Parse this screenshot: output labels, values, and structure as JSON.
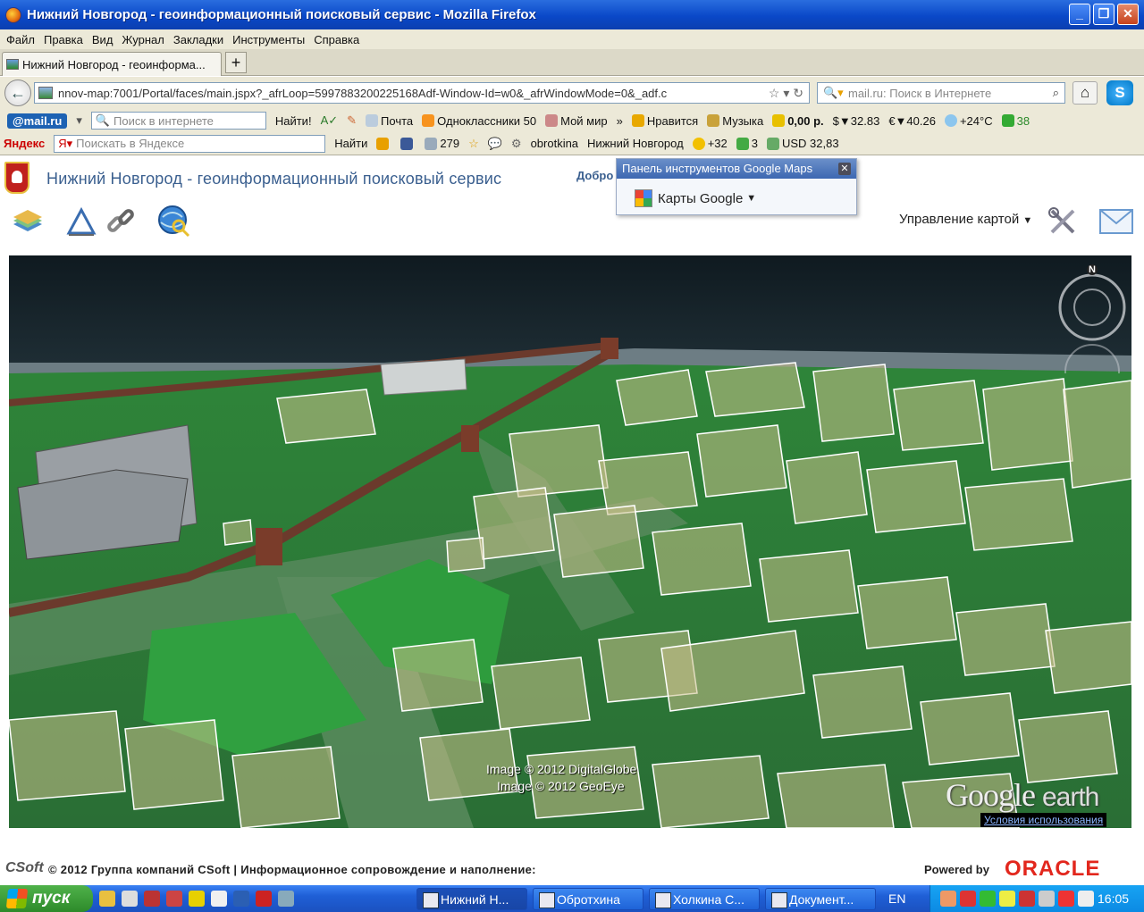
{
  "window": {
    "title": "Нижний Новгород - геоинформационный поисковый сервис - Mozilla Firefox"
  },
  "menu": [
    "Файл",
    "Правка",
    "Вид",
    "Журнал",
    "Закладки",
    "Инструменты",
    "Справка"
  ],
  "tab": {
    "label": "Нижний Новгород - геоинформа...",
    "new_tab": "+"
  },
  "nav": {
    "url": "nnov-map:7001/Portal/faces/main.jspx?_afrLoop=5997883200225168Adf-Window-Id=w0&_afrWindowMode=0&_adf.c",
    "search_placeholder": "mail.ru: Поиск в Интернете"
  },
  "toolbar1": {
    "brand": "@mail.ru",
    "search_placeholder": "Поиск в интернете",
    "find": "Найти!",
    "items": [
      "Почта",
      "Одноклассники 50",
      "Мой мир",
      "»",
      "Нравится",
      "Музыка",
      "0,00 р.",
      "$▼32.83",
      "€▼40.26",
      "+24°C",
      "38"
    ]
  },
  "toolbar2": {
    "brand": "Яндекс",
    "search_placeholder": "Поискать в Яндексе",
    "find": "Найти",
    "mail_count": "279",
    "user": "obrotkina",
    "city": "Нижний Новгород",
    "weather": "+32",
    "score": "3",
    "usd": "USD 32,83"
  },
  "page": {
    "title": "Нижний Новгород - геоинформационный поисковый сервис",
    "greeting": "Добро",
    "map_menu": "Управление картой"
  },
  "gpanel": {
    "header": "Панель инструментов Google Maps",
    "button": "Карты Google"
  },
  "map": {
    "credit1": "Image © 2012 DigitalGlobe",
    "credit2": "Image © 2012 GeoEye",
    "brand": "Google",
    "brand2": "earth",
    "terms": "Условия использования",
    "north": "N"
  },
  "footer": {
    "logo": "CSoft",
    "text": "© 2012 Группа компаний CSoft | Информационное сопровождение и наполнение:",
    "powered": "Powered by",
    "oracle": "ORACLE"
  },
  "taskbar": {
    "start": "пуск",
    "tasks": [
      "Нижний Н...",
      "Обротхина",
      "Холкина С...",
      "Документ..."
    ],
    "lang": "EN",
    "time": "16:05"
  }
}
